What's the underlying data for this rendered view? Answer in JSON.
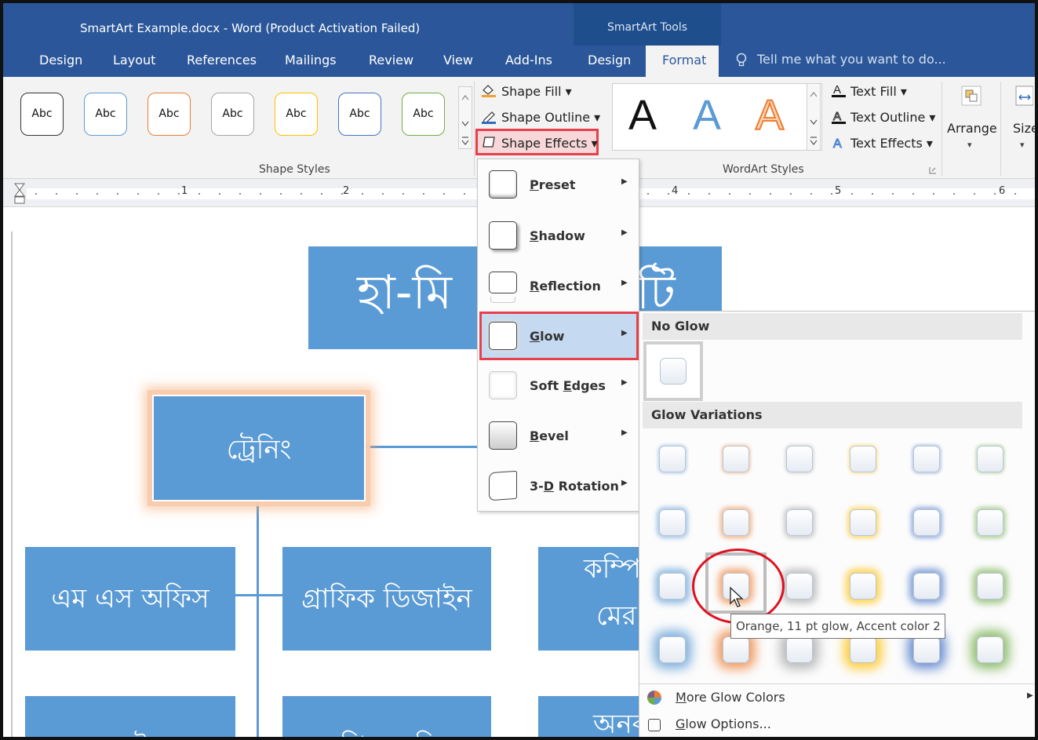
{
  "window": {
    "title": "SmartArt Example.docx - Word (Product Activation Failed)",
    "context_tab_group": "SmartArt Tools"
  },
  "tabs": [
    "Design",
    "Layout",
    "References",
    "Mailings",
    "Review",
    "View",
    "Add-Ins",
    "Design",
    "Format"
  ],
  "active_tab": "Format",
  "tell_me": "Tell me what you want to do...",
  "ribbon": {
    "shape_styles": {
      "swatches": [
        {
          "label": "Abc",
          "color": "#333333"
        },
        {
          "label": "Abc",
          "color": "#5b9bd5"
        },
        {
          "label": "Abc",
          "color": "#ed7d31"
        },
        {
          "label": "Abc",
          "color": "#a5a5a5"
        },
        {
          "label": "Abc",
          "color": "#ffc000"
        },
        {
          "label": "Abc",
          "color": "#4472c4"
        },
        {
          "label": "Abc",
          "color": "#70ad47"
        }
      ],
      "shape_fill": "Shape Fill",
      "shape_outline": "Shape Outline",
      "shape_effects": "Shape Effects",
      "group_label": "Shape Styles"
    },
    "wordart_styles": {
      "letters": [
        {
          "char": "A",
          "color": "#111111"
        },
        {
          "char": "A",
          "color": "#5b9bd5"
        },
        {
          "char": "A",
          "color": "#f4b183"
        }
      ],
      "text_fill": "Text Fill",
      "text_outline": "Text Outline",
      "text_effects": "Text Effects",
      "group_label": "WordArt Styles"
    },
    "arrange": "Arrange",
    "size": "Size"
  },
  "ruler": {
    "numbers": [
      "1",
      "2",
      "4",
      "5",
      "6"
    ]
  },
  "document": {
    "title_node": "হা-মি",
    "title_node_right": "টি",
    "training_node": "ট্রেনিং",
    "child_nodes": [
      "এম এস অফিস",
      "গ্রাফিক ডিজাইন",
      "কম্পি",
      "মের"
    ],
    "bottom_nodes": [
      "এসইও",
      "পি এলসি",
      "অনব"
    ]
  },
  "effects_menu": {
    "items": [
      {
        "label": "Preset",
        "key": "P"
      },
      {
        "label": "Shadow",
        "key": "S"
      },
      {
        "label": "Reflection",
        "key": "R"
      },
      {
        "label": "Glow",
        "key": "G"
      },
      {
        "label": "Soft Edges",
        "key": "E"
      },
      {
        "label": "Bevel",
        "key": "B"
      },
      {
        "label": "3-D Rotation",
        "key": "D"
      }
    ],
    "highlighted": "Glow"
  },
  "glow_menu": {
    "no_glow_header": "No Glow",
    "variations_header": "Glow Variations",
    "glow_colors": [
      "#5b9bd5",
      "#ed7d31",
      "#a5a5a5",
      "#ffc000",
      "#4472c4",
      "#70ad47"
    ],
    "glow_sizes": [
      "5 pt",
      "8 pt",
      "11 pt",
      "18 pt"
    ],
    "tooltip": "Orange, 11 pt glow, Accent color 2",
    "more_colors": "More Glow Colors",
    "options": "Glow Options..."
  }
}
